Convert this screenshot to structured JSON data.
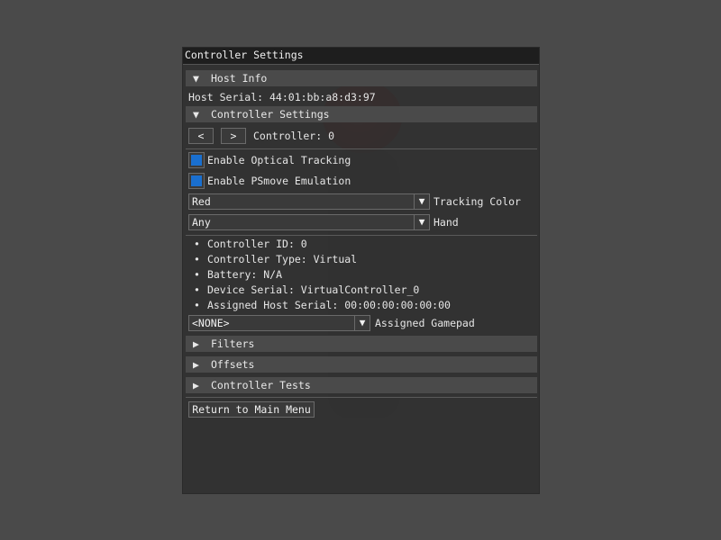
{
  "window": {
    "title": "Controller Settings"
  },
  "host_info": {
    "header": "Host Info",
    "serial_label": "Host Serial: 44:01:bb:a8:d3:97"
  },
  "controller_settings": {
    "header": "Controller Settings",
    "prev_button": "<",
    "next_button": ">",
    "controller_label": "Controller: 0",
    "optical_tracking": {
      "label": "Enable Optical Tracking",
      "checked": true
    },
    "psmove_emulation": {
      "label": "Enable PSmove Emulation",
      "checked": true
    },
    "tracking_color": {
      "value": "Red",
      "label": "Tracking Color"
    },
    "hand": {
      "value": "Any",
      "label": "Hand"
    },
    "info_items": [
      "Controller ID: 0",
      "Controller Type: Virtual",
      "Battery: N/A",
      "Device Serial: VirtualController_0",
      "Assigned Host Serial: 00:00:00:00:00:00"
    ],
    "gamepad": {
      "value": "<NONE>",
      "label": "Assigned Gamepad"
    }
  },
  "collapsed_sections": {
    "filters": "Filters",
    "offsets": "Offsets",
    "tests": "Controller Tests"
  },
  "return_button": "Return to Main Menu",
  "icons": {
    "expanded": "▼",
    "collapsed": "▶",
    "dropdown": "▼"
  },
  "colors": {
    "accent": "#1a6fcf",
    "header_bg": "#4a4a4a",
    "window_bg": "#303030",
    "title_bg": "#1e1e1e"
  }
}
